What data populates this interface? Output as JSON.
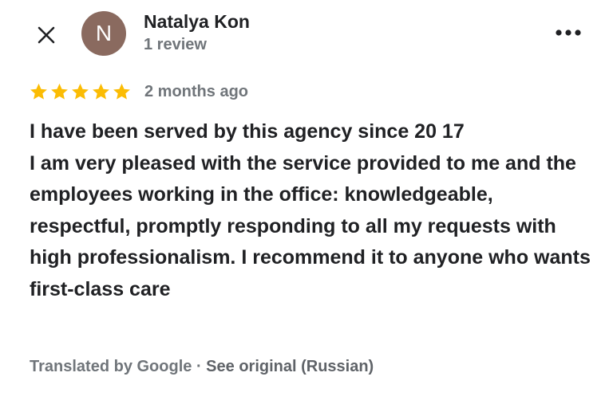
{
  "header": {
    "close_icon": "close-icon",
    "avatar_letter": "N",
    "avatar_color": "#8a6a5f",
    "author_name": "Natalya Kon",
    "author_meta": "1 review",
    "more_icon": "more-vert-icon"
  },
  "review": {
    "rating": 5,
    "rating_max": 5,
    "star_color": "#fbbc04",
    "date": "2 months ago",
    "text": "I have been served by this agency since 20 17\nI am very pleased with the service provided to me and the employees working in the office: knowledgeable, respectful, promptly responding to all my requests with high professionalism. I recommend it to anyone who wants first-class care"
  },
  "translation": {
    "label": "Translated by Google",
    "separator": " · ",
    "see_original_label": "See original (Russian)"
  }
}
